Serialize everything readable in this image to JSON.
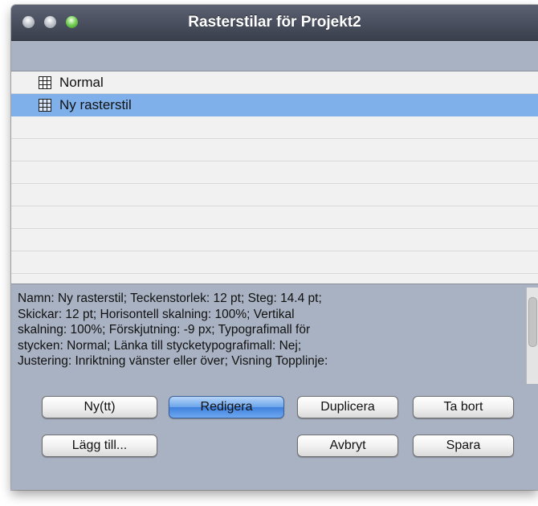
{
  "window": {
    "title": "Rasterstilar för Projekt2"
  },
  "styles_list": {
    "items": [
      {
        "label": "Normal",
        "icon": "grid-icon",
        "selected": false
      },
      {
        "label": "Ny rasterstil",
        "icon": "grid-icon",
        "selected": true
      }
    ]
  },
  "description": {
    "line1": "Namn: Ny rasterstil; Teckenstorlek: 12 pt; Steg: 14.4 pt;",
    "line2": "Skickar: 12 pt; Horisontell skalning: 100%; Vertikal",
    "line3": "skalning: 100%; Förskjutning: -9 px; Typografimall för",
    "line4": "stycken: Normal; Länka till stycketypografimall: Nej;",
    "line5": "Justering: Inriktning vänster eller över; Visning Topplinje:"
  },
  "buttons": {
    "new": "Ny(tt)",
    "edit": "Redigera",
    "duplicate": "Duplicera",
    "delete": "Ta bort",
    "add": "Lägg till...",
    "cancel": "Avbryt",
    "save": "Spara"
  },
  "colors": {
    "selection": "#7fb0ea",
    "window_bg": "#a9b2c2",
    "titlebar": "#3a3f4d",
    "default_button": "#3f81de"
  }
}
